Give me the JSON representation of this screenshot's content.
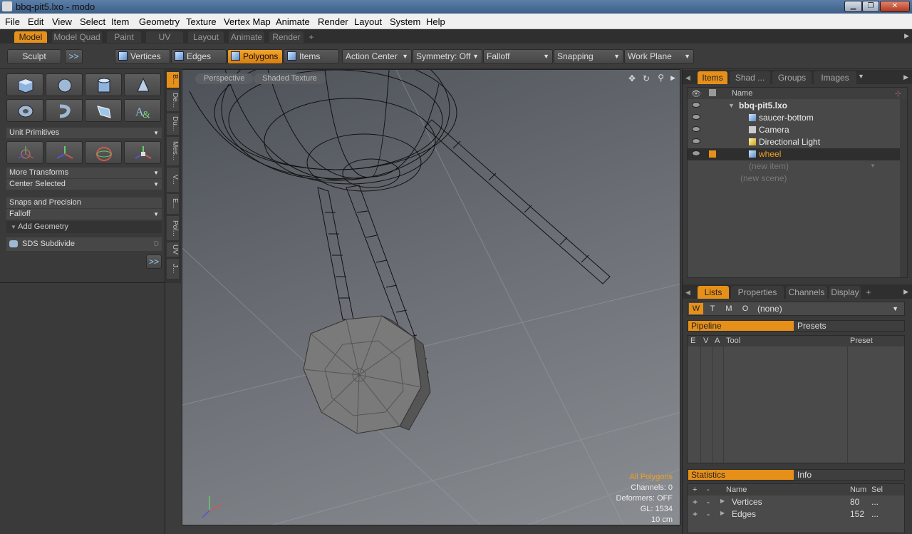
{
  "window": {
    "title": "bbq-pit5.lxo - modo"
  },
  "menu": [
    "File",
    "Edit",
    "View",
    "Select",
    "Item",
    "Geometry",
    "Texture",
    "Vertex Map",
    "Animate",
    "Render",
    "Layout",
    "System",
    "Help"
  ],
  "layout_tabs": [
    "Model",
    "Model Quad",
    "Paint",
    "UV",
    "Layout",
    "Animate",
    "Render",
    "+"
  ],
  "toolbar": {
    "sculpt": "Sculpt",
    "more": ">>",
    "vertices": "Vertices",
    "edges": "Edges",
    "polygons": "Polygons",
    "items": "Items",
    "action_center": "Action Center",
    "symmetry": "Symmetry: Off",
    "falloff": "Falloff",
    "snapping": "Snapping",
    "work_plane": "Work Plane"
  },
  "left_panel": {
    "unit_primitives": "Unit Primitives",
    "more_transforms": "More Transforms",
    "center_selected": "Center Selected",
    "snaps_precision": "Snaps and Precision",
    "falloff": "Falloff",
    "add_geometry": "Add Geometry",
    "sds_subdivide": "SDS Subdivide",
    "sds_key": "D",
    "more": ">>"
  },
  "vertical_tabs": [
    "B...",
    "De...",
    "Du...",
    "Mes...",
    "V...",
    "E...",
    "Pol...",
    "UV",
    "J..."
  ],
  "viewport": {
    "view": "Perspective",
    "shading": "Shaded Texture",
    "info_mode": "All Polygons",
    "channels": "Channels: 0",
    "deformers": "Deformers: OFF",
    "gl": "GL: 1534",
    "scale": "10 cm"
  },
  "items_panel": {
    "tabs": [
      "Items",
      "Shad ...",
      "Groups",
      "Images"
    ],
    "name_header": "Name",
    "rows": [
      {
        "label": "bbq-pit5.lxo"
      },
      {
        "label": "saucer-bottom"
      },
      {
        "label": "Camera"
      },
      {
        "label": "Directional Light"
      },
      {
        "label": "wheel"
      }
    ],
    "new_item": "(new item)",
    "new_scene": "(new scene)"
  },
  "lists_panel": {
    "tabs": [
      "Lists",
      "Properties",
      "Channels",
      "Display",
      "+"
    ],
    "wtmo": [
      "W",
      "T",
      "M",
      "O"
    ],
    "none": "(none)",
    "pipeline": "Pipeline",
    "presets": "Presets",
    "cols": [
      "E",
      "V",
      "A",
      "Tool",
      "Preset"
    ],
    "statistics": "Statistics",
    "info": "Info",
    "stat_cols": [
      "+",
      "-",
      "Name",
      "Num",
      "Sel"
    ],
    "stat_rows": [
      {
        "plus": "+",
        "minus": "-",
        "name": "Vertices",
        "num": "80",
        "sel": "..."
      },
      {
        "plus": "+",
        "minus": "-",
        "name": "Edges",
        "num": "152",
        "sel": "..."
      }
    ]
  }
}
